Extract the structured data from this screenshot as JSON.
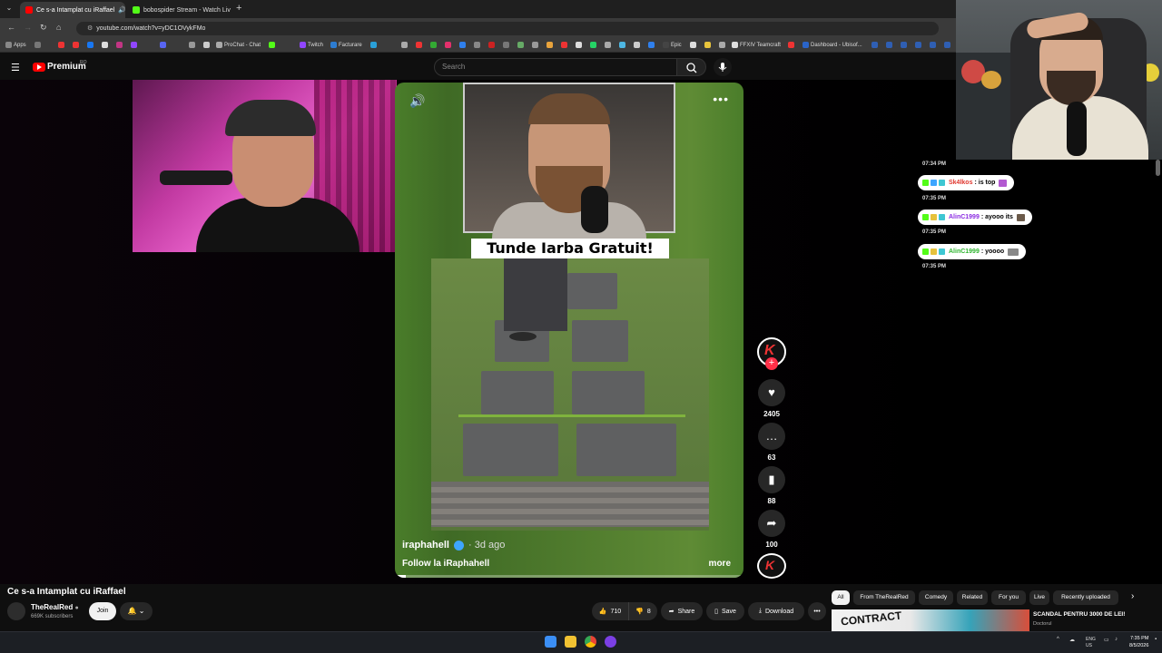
{
  "browser": {
    "tabs": [
      {
        "label": "Ce s-a Intamplat cu iRaffael",
        "active": true,
        "favicon_color": "#ff0000"
      },
      {
        "label": "bobospider Stream - Watch Liv",
        "active": false,
        "favicon_color": "#53fc18"
      }
    ],
    "url": "youtube.com/watch?v=yDC1OVykFMo",
    "bookmarks": [
      {
        "label": "Apps"
      },
      {
        "label": "ProChat - Chat"
      },
      {
        "label": "Twitch"
      },
      {
        "label": "Facturare"
      },
      {
        "label": "Epic"
      },
      {
        "label": "FFXIV Teamcraft"
      },
      {
        "label": "Dashboard - Ubisof..."
      }
    ]
  },
  "youtube": {
    "logo_text": "Premium",
    "country_code": "RO",
    "search_placeholder": "Search"
  },
  "short": {
    "caption": "Tunde Iarba Gratuit!",
    "author": "iraphahell",
    "age": "3d ago",
    "description": "Follow la iRaphahell",
    "more_label": "more",
    "progress": 0.03,
    "actions": [
      {
        "icon": "heart-icon",
        "glyph": "♥",
        "count": "2405"
      },
      {
        "icon": "comment-icon",
        "glyph": "…",
        "count": "63"
      },
      {
        "icon": "bookmark-icon",
        "glyph": "▮",
        "count": "88"
      },
      {
        "icon": "share-icon",
        "glyph": "➦",
        "count": "100"
      }
    ]
  },
  "chat": {
    "messages": [
      {
        "time": "07:34 PM",
        "user": "Sk4lkos",
        "user_color": "#e0382f",
        "text": ": is top"
      },
      {
        "time": "07:35 PM",
        "user": "AlinC1999",
        "user_color": "#8a2be2",
        "text": ": ayooo its"
      },
      {
        "time": "07:35 PM",
        "user": "AlinC1999",
        "user_color": "#2fb52f",
        "text": ": yoooo"
      }
    ],
    "trailing_time": "07:35 PM"
  },
  "video": {
    "title": "Ce s-a Intamplat cu iRaffael",
    "channel": "TheRealRed",
    "subscribers": "669K subscribers",
    "join_label": "Join",
    "likes": "710",
    "dislikes": "8",
    "share_label": "Share",
    "save_label": "Save",
    "download_label": "Download"
  },
  "filters": {
    "chips": [
      "All",
      "From TheRealRed",
      "Comedy",
      "Related",
      "For you",
      "Live",
      "Recently uploaded"
    ]
  },
  "recommended": {
    "title": "SCANDAL PENTRU 3000 DE LEI!",
    "channel": "Doctorul",
    "thumb_text": "CONTRACT"
  },
  "taskbar": {
    "lang": "ENG",
    "region": "US",
    "time": "7:35 PM",
    "date": "8/5/2026"
  },
  "colors": {
    "accent_red": "#ff0000",
    "verified_blue": "#3ea6ff",
    "kick_green": "#53fc18"
  }
}
